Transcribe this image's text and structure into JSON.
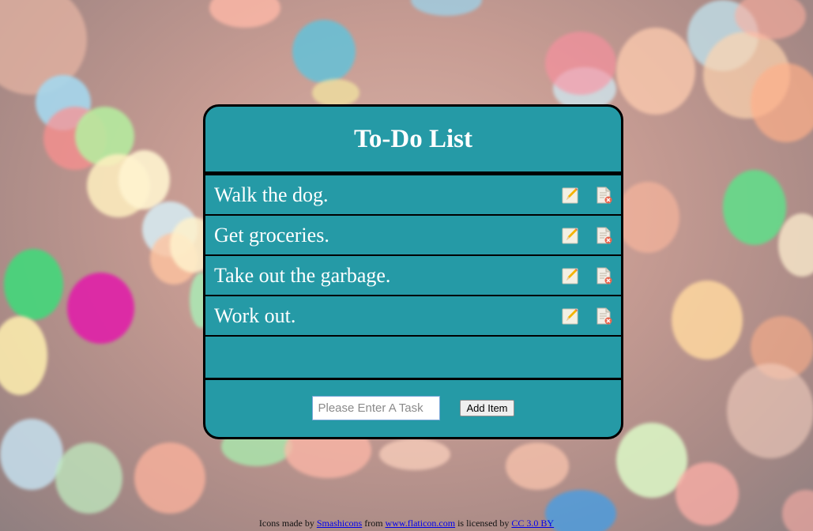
{
  "app": {
    "title": "To-Do List"
  },
  "tasks": [
    {
      "text": "Walk the dog."
    },
    {
      "text": "Get groceries."
    },
    {
      "text": "Take out the garbage."
    },
    {
      "text": "Work out."
    }
  ],
  "input": {
    "placeholder": "Please Enter A Task",
    "value": ""
  },
  "buttons": {
    "add_label": "Add Item"
  },
  "icons": {
    "edit": "pencil-note-icon",
    "delete": "document-delete-icon"
  },
  "footer": {
    "prefix": "Icons made by",
    "author_link": "Smashicons",
    "middle": "from",
    "site_link": "www.flaticon.com",
    "licensed": "is licensed by",
    "license_link": "CC 3.0 BY"
  },
  "colors": {
    "card_bg": "#259aa6",
    "border": "#000000",
    "text": "#ffffff"
  }
}
